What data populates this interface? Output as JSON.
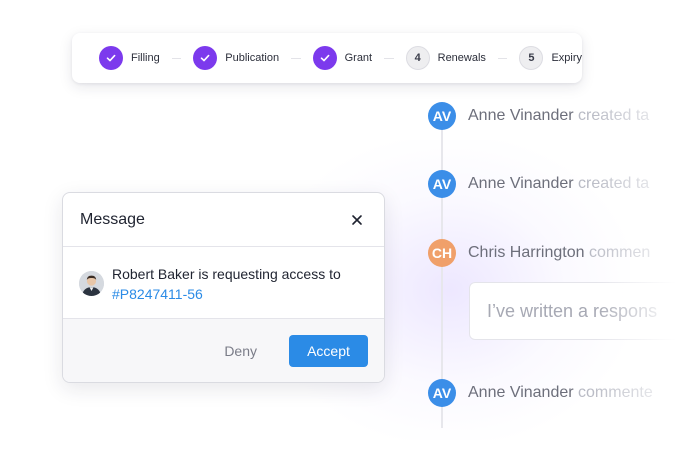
{
  "stepper": {
    "steps": [
      {
        "label": "Filling",
        "state": "done",
        "marker": ""
      },
      {
        "label": "Publication",
        "state": "done",
        "marker": ""
      },
      {
        "label": "Grant",
        "state": "done",
        "marker": ""
      },
      {
        "label": "Renewals",
        "state": "todo",
        "marker": "4"
      },
      {
        "label": "Expiry",
        "state": "todo",
        "marker": "5"
      }
    ]
  },
  "timeline": {
    "items": [
      {
        "initials": "AV",
        "name": "Anne Vinander",
        "action": "created ta",
        "color": "#3b8ee8"
      },
      {
        "initials": "AV",
        "name": "Anne Vinander",
        "action": "created ta",
        "color": "#3b8ee8"
      },
      {
        "initials": "CH",
        "name": "Chris Harrington",
        "action": "commen",
        "color": "#f0a06a"
      },
      {
        "initials": "AV",
        "name": "Anne Vinander",
        "action": "commente",
        "color": "#3b8ee8"
      }
    ],
    "comment_text": "I’ve written a respons"
  },
  "dialog": {
    "title": "Message",
    "requester_text": "Robert Baker is requesting access to",
    "reference_link": "#P8247411-56",
    "deny_label": "Deny",
    "accept_label": "Accept"
  },
  "colors": {
    "accent_purple": "#7c3aed",
    "primary_blue": "#2b8be6"
  }
}
